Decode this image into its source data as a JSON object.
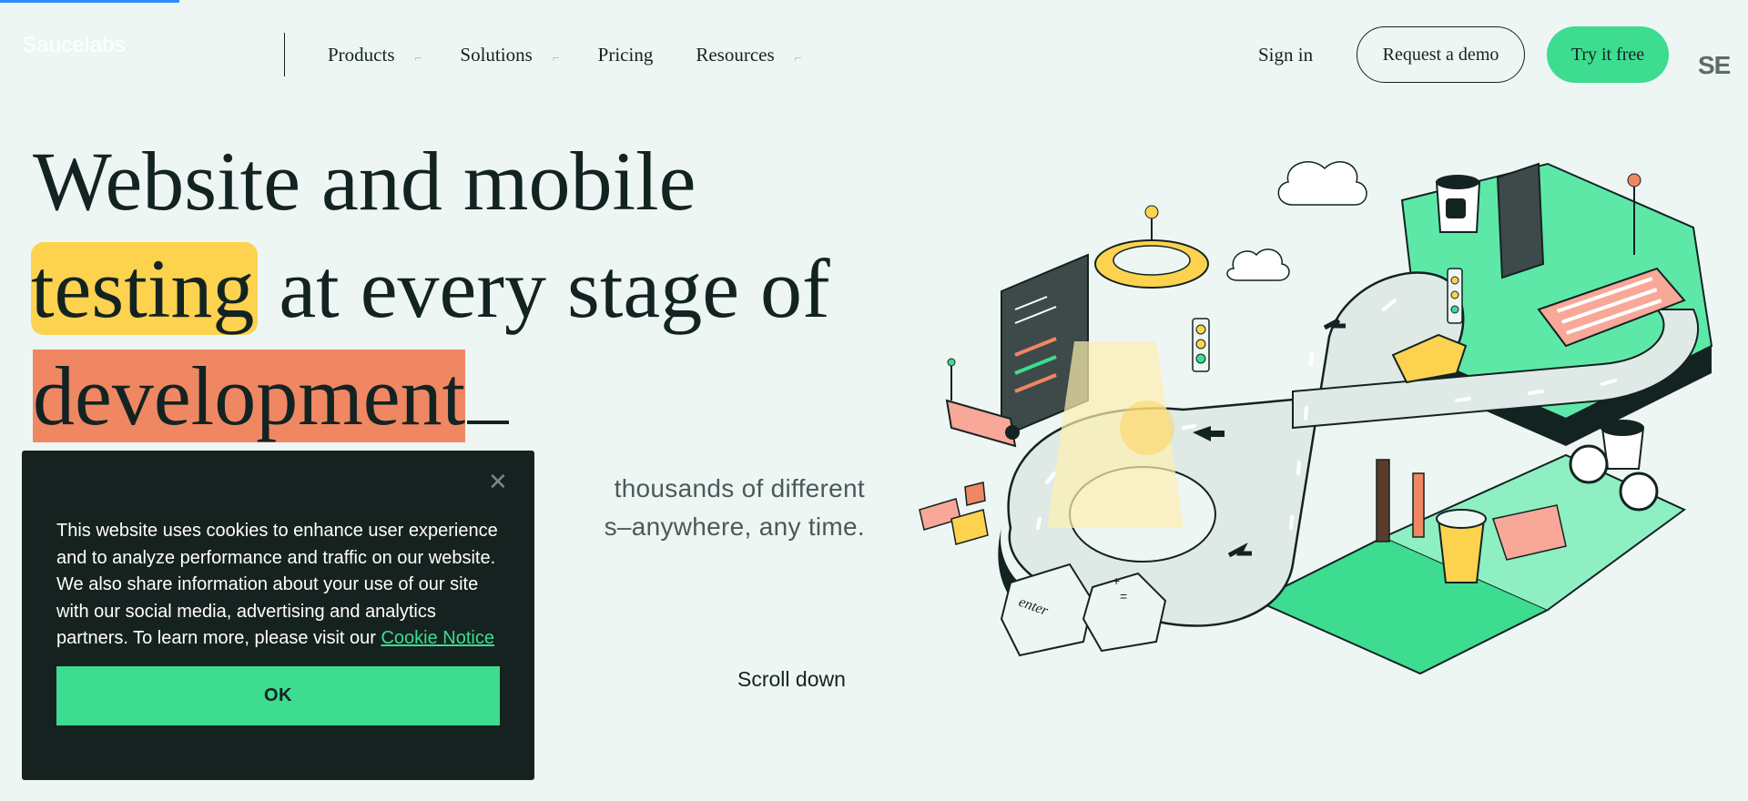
{
  "header": {
    "logo": "Saucelabs",
    "nav": [
      {
        "label": "Products",
        "has_dropdown": true
      },
      {
        "label": "Solutions",
        "has_dropdown": true
      },
      {
        "label": "Pricing",
        "has_dropdown": false
      },
      {
        "label": "Resources",
        "has_dropdown": true
      }
    ],
    "sign_in": "Sign in",
    "request_demo": "Request a demo",
    "try_free": "Try it free",
    "search_partial": "SE"
  },
  "hero": {
    "title_line1": "Website and mobile",
    "title_highlight1": "testing",
    "title_line2_rest": " at every stage of",
    "title_highlight2": "development",
    "subtext_line1": "thousands of different",
    "subtext_line2": "s–anywhere, any time.",
    "scroll_down": "Scroll down"
  },
  "illustration": {
    "key_enter": "enter",
    "key_plus": "+",
    "key_equals": "="
  },
  "cookie": {
    "text": "This website uses cookies to enhance user experience and to analyze performance and traffic on our website. We also share information about your use of our site with our social media, advertising and analytics partners. To learn more, please visit our ",
    "link": "Cookie Notice",
    "ok": "OK",
    "close": "✕"
  },
  "colors": {
    "background": "#eef6f4",
    "accent_green": "#3ddc91",
    "highlight_yellow": "#fdd24f",
    "highlight_orange": "#f08763",
    "dark": "#132322",
    "cookie_bg": "#162220"
  },
  "icons": [
    "chevron-down-icon",
    "close-icon"
  ]
}
